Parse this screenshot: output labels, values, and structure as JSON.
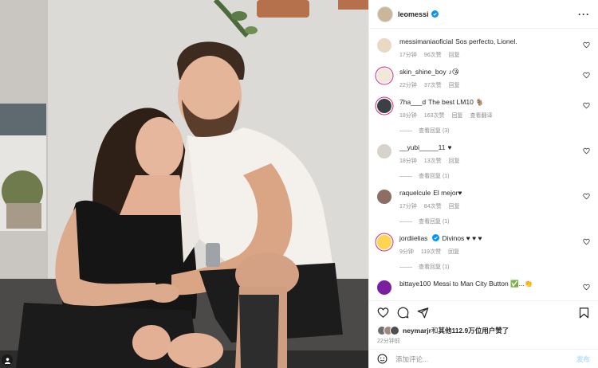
{
  "post": {
    "author": "leomessi",
    "more_icon": "more-horizontal-icon"
  },
  "comments": [
    {
      "user": "messimaniaoficial",
      "text": "Sos perfecto, Lionel.",
      "time": "17分钟",
      "likes": "96次赞",
      "reply": "回复",
      "avatar_color": "#e9d9c2",
      "ring": false
    },
    {
      "user": "skin_shine_boy",
      "text": "♪😘",
      "time": "22分钟",
      "likes": "37次赞",
      "reply": "回复",
      "avatar_color": "#f3e7da",
      "ring": true
    },
    {
      "user": "7ha___d",
      "text": "The best LM10 🐐",
      "time": "18分钟",
      "likes": "163次赞",
      "reply": "回复",
      "translate": "查看翻译",
      "view_replies": "查看回复 (3)",
      "avatar_color": "#3b3f46",
      "ring": true
    },
    {
      "user": "__yubi_____11",
      "text": "♥",
      "time": "18分钟",
      "likes": "13次赞",
      "reply": "回复",
      "view_replies": "查看回复 (1)",
      "avatar_color": "#d7d2cb",
      "ring": false
    },
    {
      "user": "raquelcule",
      "text": "El mejor♥",
      "time": "17分钟",
      "likes": "84次赞",
      "reply": "回复",
      "view_replies": "查看回复 (1)",
      "avatar_color": "#8d6e63",
      "ring": false
    },
    {
      "user": "jordiielias",
      "text": "Divinos ♥ ♥ ♥",
      "time": "9分钟",
      "likes": "119次赞",
      "reply": "回复",
      "view_replies": "查看回复 (1)",
      "avatar_color": "#ffd54f",
      "ring": true,
      "verified": true
    },
    {
      "user": "bittaye100",
      "text": "Messi to Man City Button ✅...👏",
      "time": "",
      "likes": "",
      "reply": "",
      "avatar_color": "#7b1fa2",
      "ring": false
    }
  ],
  "likes_summary": {
    "prefix": "neymarjr",
    "middle": "和",
    "count_text": "其他112.9万位用户",
    "suffix": "赞了"
  },
  "time_ago": "22分钟前",
  "add_comment": {
    "placeholder": "添加评论...",
    "post_label": "发布"
  },
  "colors": {
    "verified": "#0095f6",
    "heart": "#ed4956",
    "post_button_disabled": "#b2dffc"
  }
}
